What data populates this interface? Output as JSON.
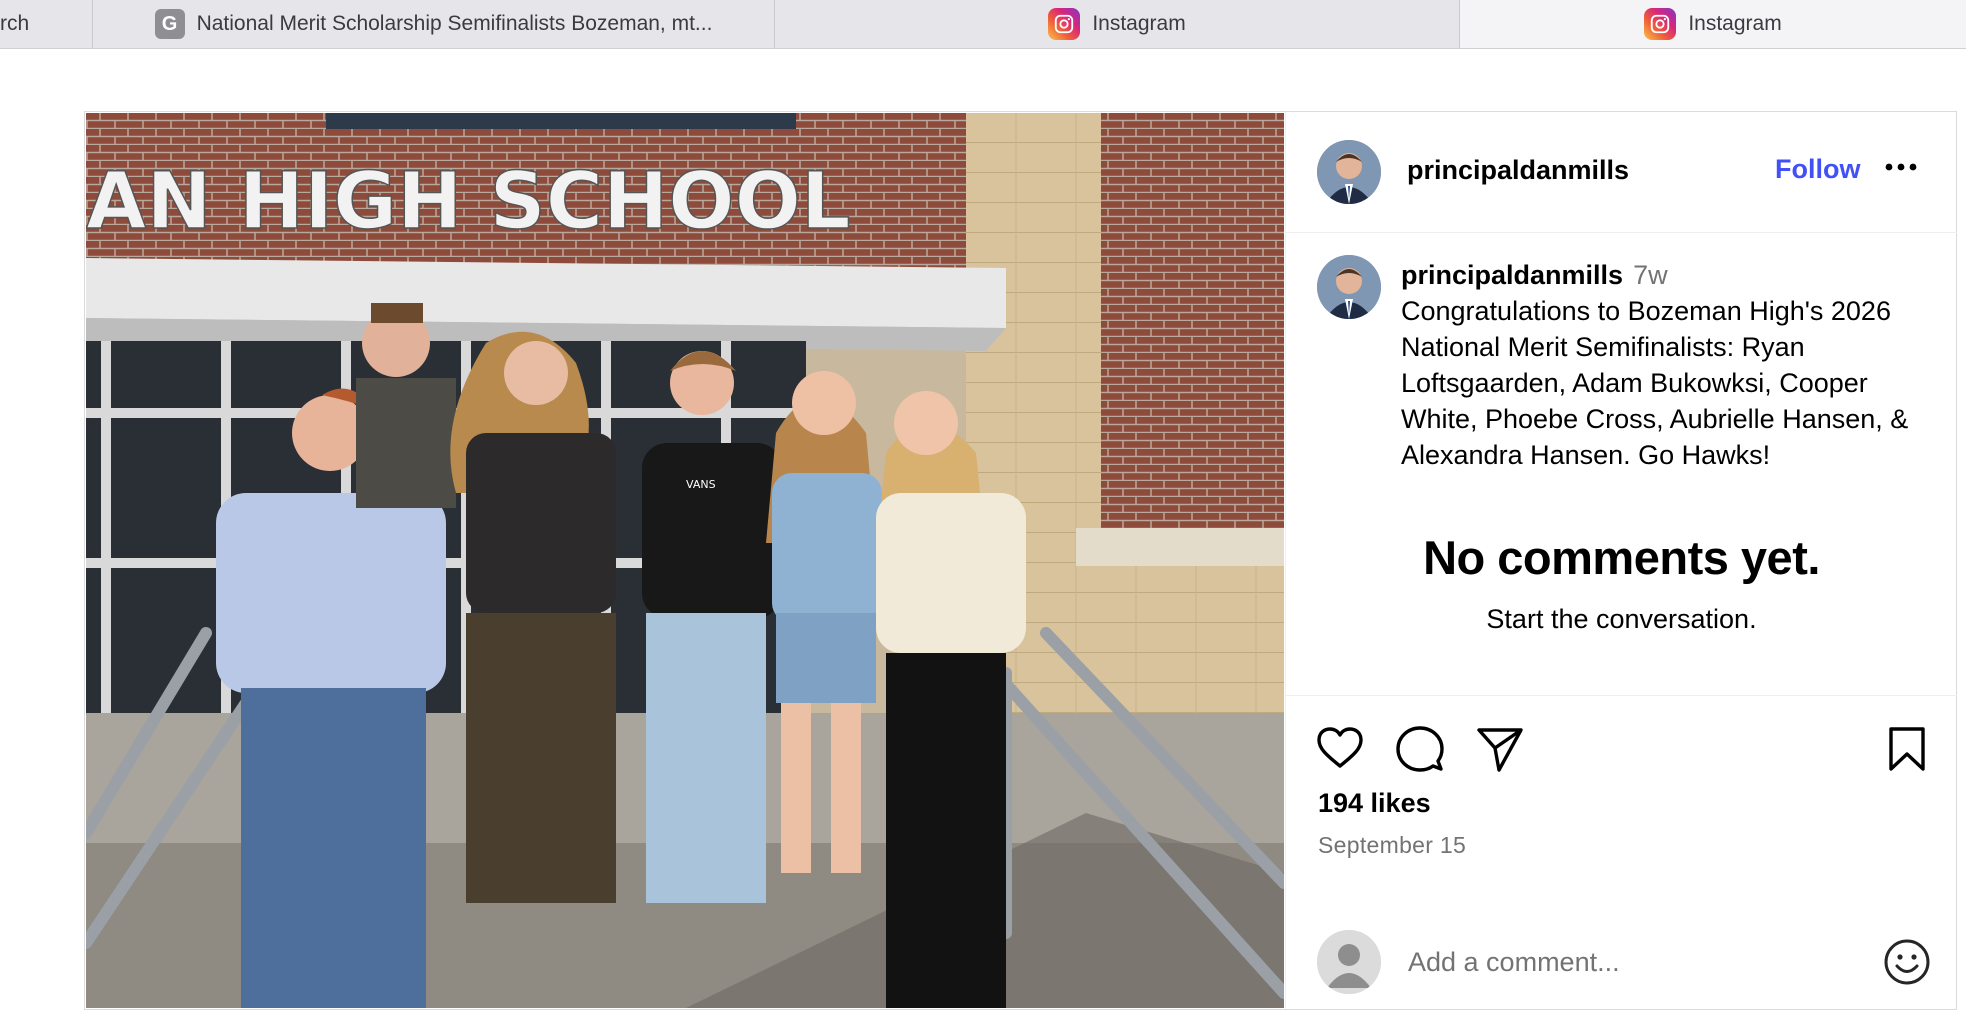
{
  "tabs": [
    {
      "title": "rch"
    },
    {
      "favicon_letter": "G",
      "title": "National Merit Scholarship Semifinalists Bozeman, mt..."
    },
    {
      "title": "Instagram"
    },
    {
      "title": "Instagram"
    }
  ],
  "photo": {
    "sign_text": "AN HIGH SCHOOL",
    "shirt_text": "VANS"
  },
  "post": {
    "username": "principaldanmills",
    "follow_label": "Follow",
    "more_label": "•••",
    "caption_username": "principaldanmills",
    "caption_time": "7w",
    "caption_text": "Congratulations to Bozeman High's 2026 National Merit Semifinalists: Ryan Loftsgaarden, Adam Bukowksi, Cooper White, Phoebe Cross, Aubrielle Hansen, & Alexandra Hansen. Go Hawks!",
    "no_comments_title": "No comments yet.",
    "no_comments_sub": "Start the conversation.",
    "likes": "194 likes",
    "date": "September 15",
    "comment_placeholder": "Add a comment..."
  },
  "icons": {
    "like": "heart-icon",
    "comment": "comment-bubble-icon",
    "share": "paper-plane-icon",
    "save": "bookmark-icon",
    "emoji": "smiley-icon",
    "user": "default-avatar-icon"
  },
  "colors": {
    "follow": "#4150f7",
    "secondary_text": "#737373",
    "tabbar": "#e6e5ea"
  }
}
